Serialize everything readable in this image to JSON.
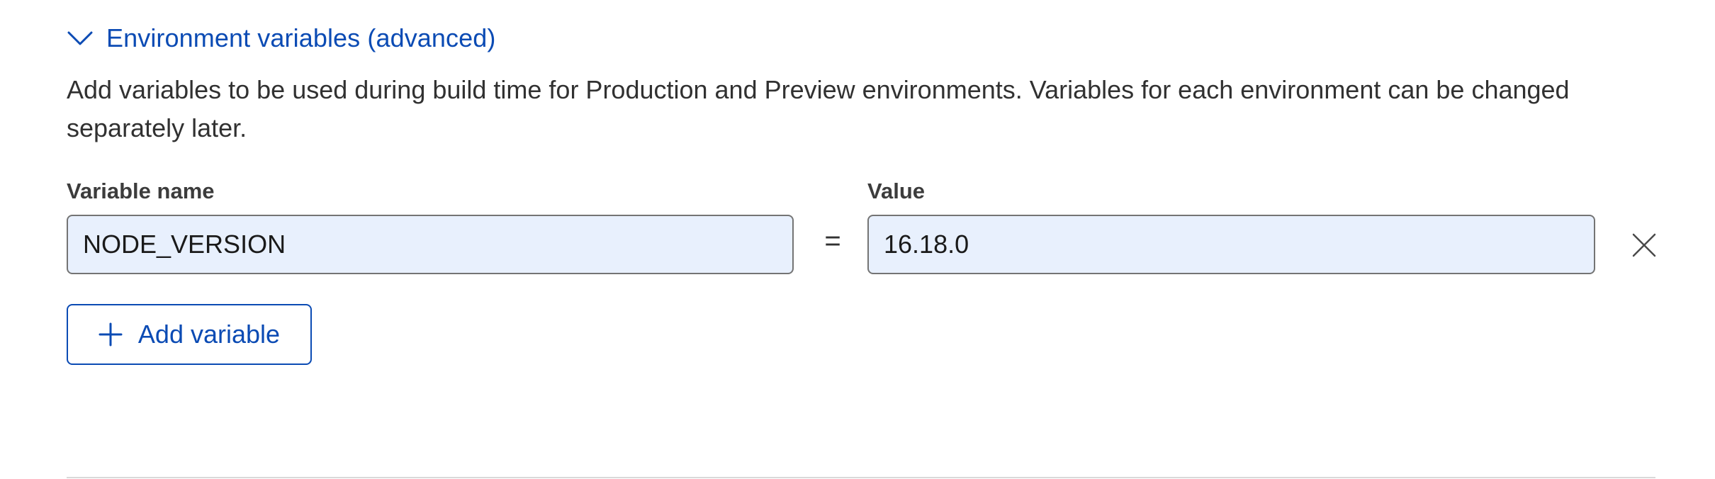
{
  "env_section": {
    "toggle_label": "Environment variables (advanced)",
    "expanded": true,
    "description": "Add variables to be used during build time for Production and Preview environments. Variables for each environment can be changed separately later."
  },
  "variables": {
    "name_label": "Variable name",
    "value_label": "Value",
    "separator": "=",
    "rows": [
      {
        "name": "NODE_VERSION",
        "value": "16.18.0"
      }
    ],
    "add_button_label": "Add variable"
  },
  "icons": {
    "toggle": "chevron-down-icon",
    "remove": "close-icon",
    "add": "plus-icon"
  },
  "colors": {
    "accent": "#0b4bb4",
    "input_background": "#e8f0fd",
    "input_border": "#747474",
    "text": "#313131",
    "divider": "#d9d9d9"
  }
}
